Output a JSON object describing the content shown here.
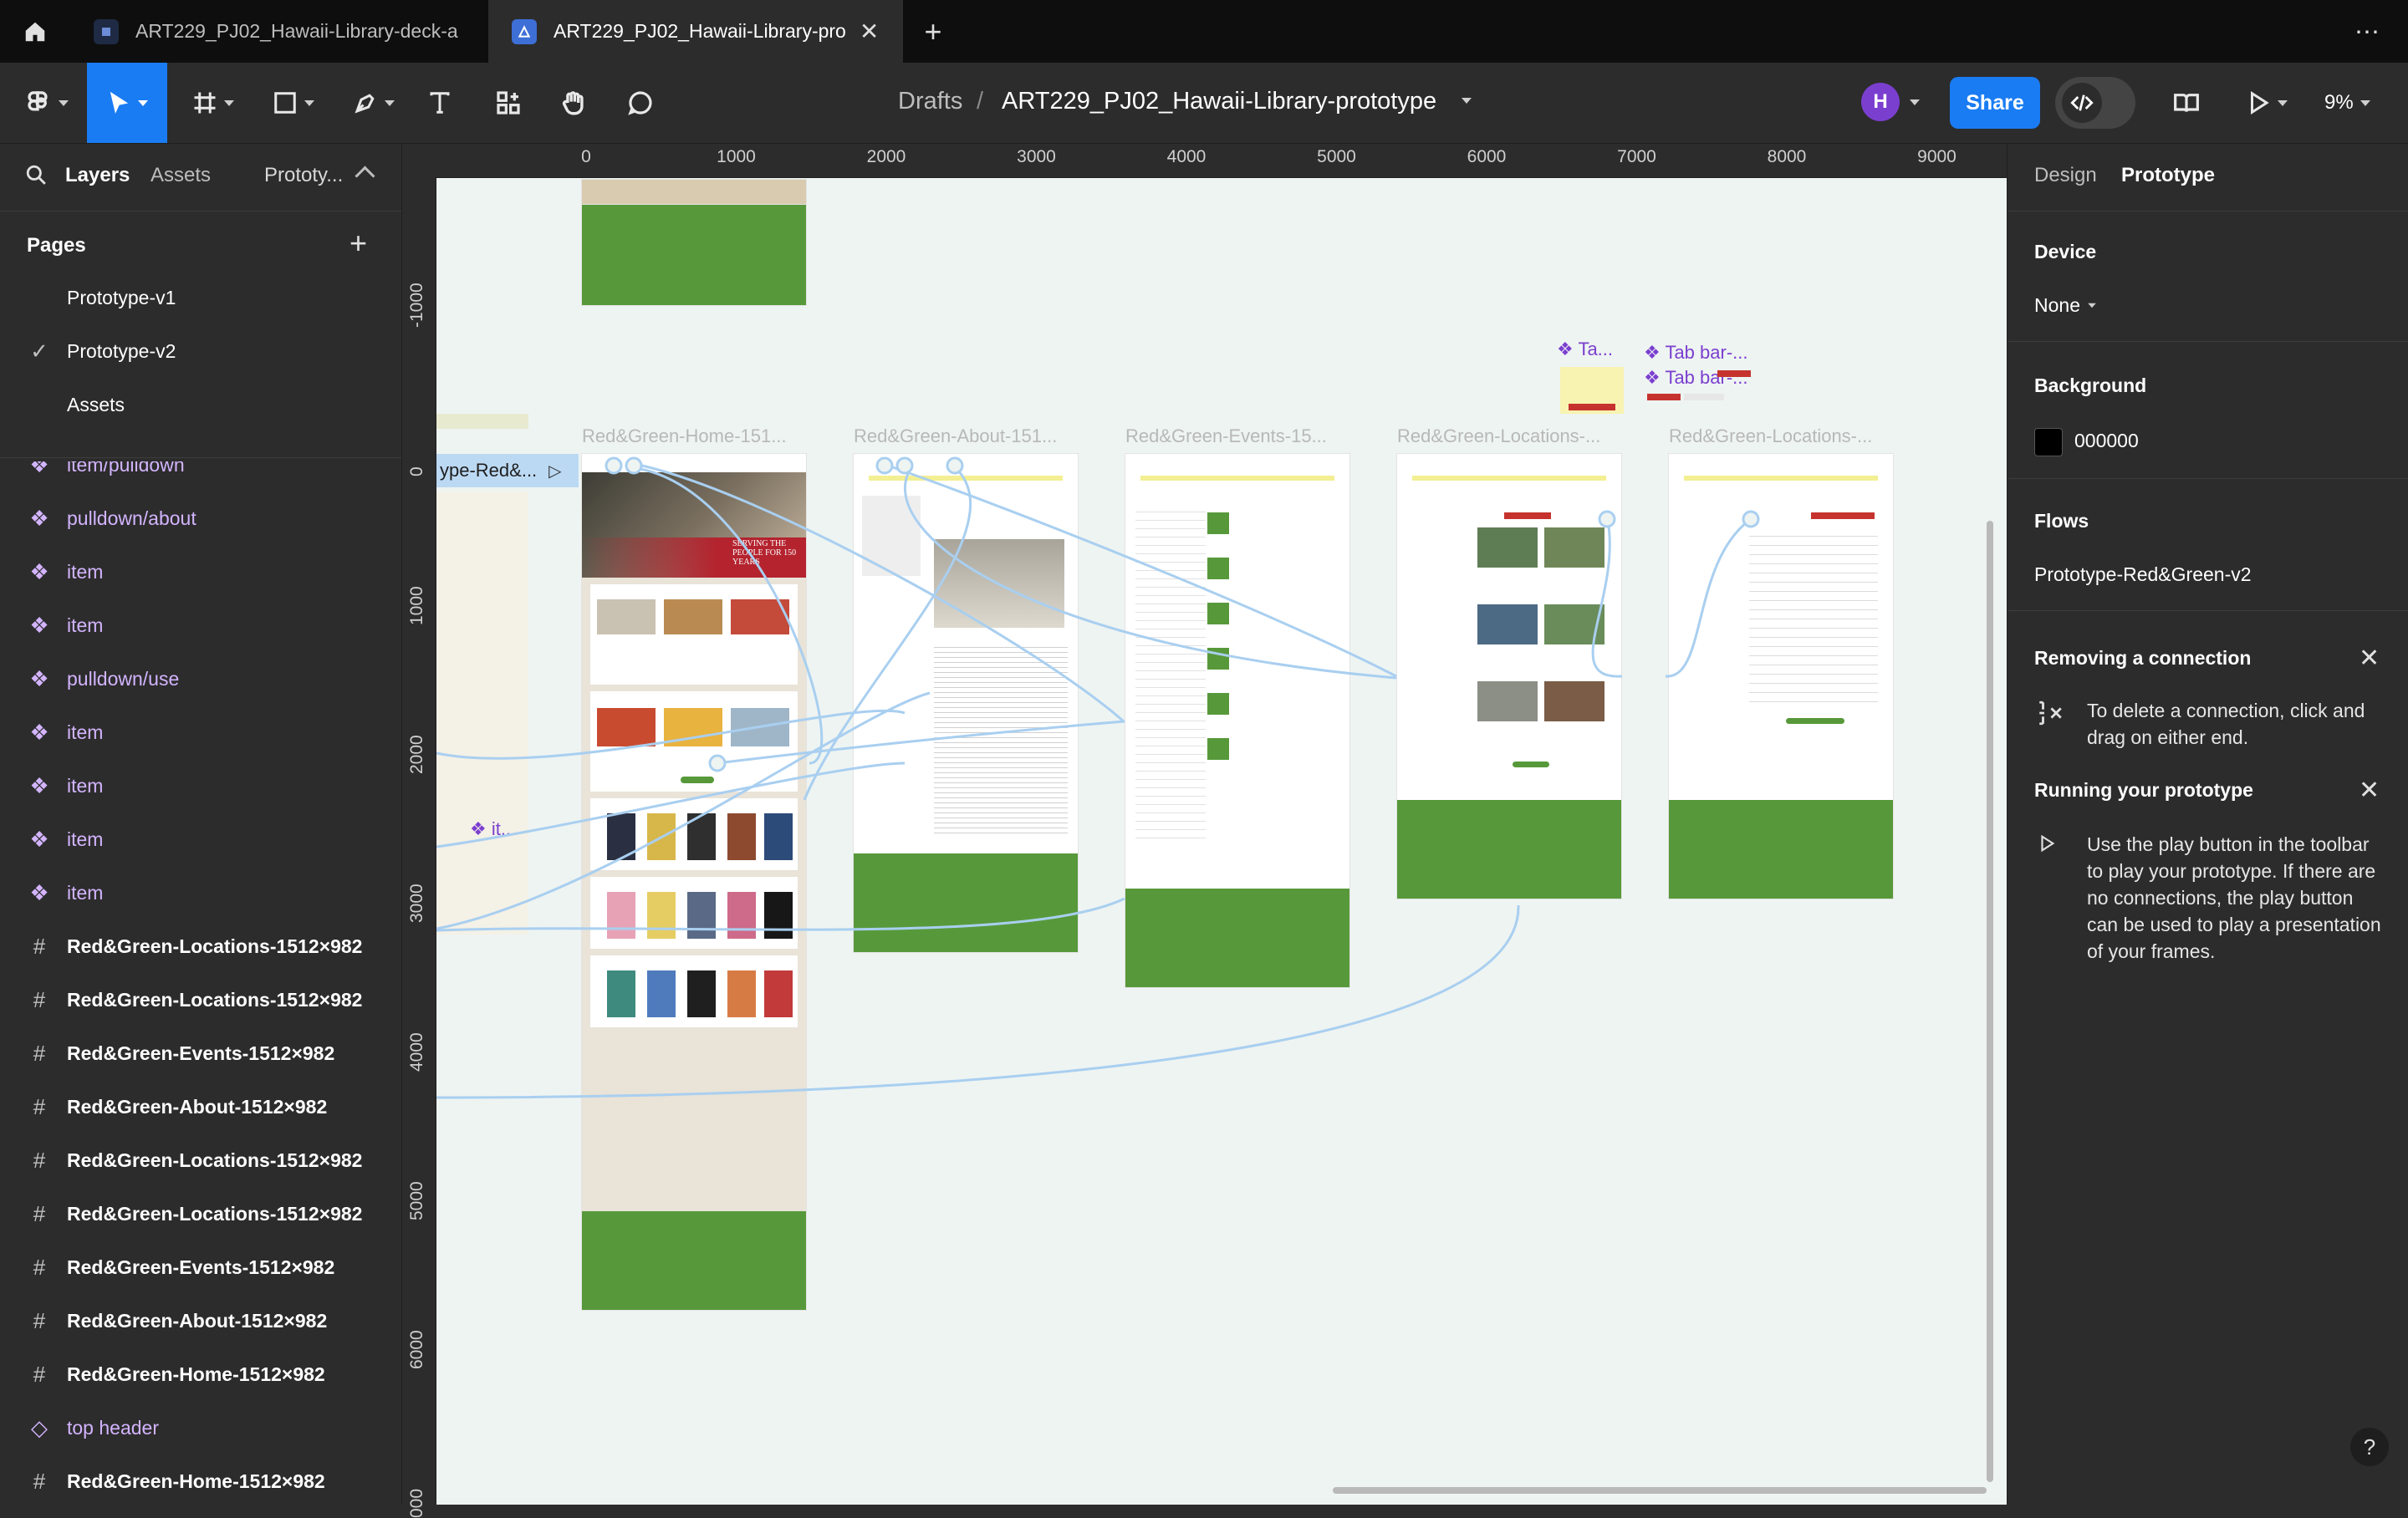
{
  "tabs": [
    {
      "label": "ART229_PJ02_Hawaii-Library-deck-a",
      "active": false
    },
    {
      "label": "ART229_PJ02_Hawaii-Library-pro",
      "active": true
    }
  ],
  "toolbar": {
    "breadcrumb_parent": "Drafts",
    "breadcrumb_sep": "/",
    "file_name": "ART229_PJ02_Hawaii-Library-prototype",
    "avatar_initial": "H",
    "share_label": "Share",
    "zoom": "9%"
  },
  "left_panel": {
    "tabs": [
      "Layers",
      "Assets",
      "Prototy..."
    ],
    "pages_title": "Pages",
    "pages": [
      {
        "name": "Prototype-v1",
        "current": false
      },
      {
        "name": "Prototype-v2",
        "current": true
      },
      {
        "name": "Assets",
        "current": false
      }
    ],
    "layers": [
      {
        "name": "item/pulldown",
        "kind": "component"
      },
      {
        "name": "pulldown/about",
        "kind": "component"
      },
      {
        "name": "item",
        "kind": "component"
      },
      {
        "name": "item",
        "kind": "component"
      },
      {
        "name": "pulldown/use",
        "kind": "component"
      },
      {
        "name": "item",
        "kind": "component"
      },
      {
        "name": "item",
        "kind": "component"
      },
      {
        "name": "item",
        "kind": "component"
      },
      {
        "name": "item",
        "kind": "component"
      },
      {
        "name": "Red&Green-Locations-1512×982",
        "kind": "frame"
      },
      {
        "name": "Red&Green-Locations-1512×982",
        "kind": "frame"
      },
      {
        "name": "Red&Green-Events-1512×982",
        "kind": "frame"
      },
      {
        "name": "Red&Green-About-1512×982",
        "kind": "frame"
      },
      {
        "name": "Red&Green-Locations-1512×982",
        "kind": "frame"
      },
      {
        "name": "Red&Green-Locations-1512×982",
        "kind": "frame"
      },
      {
        "name": "Red&Green-Events-1512×982",
        "kind": "frame"
      },
      {
        "name": "Red&Green-About-1512×982",
        "kind": "frame"
      },
      {
        "name": "Red&Green-Home-1512×982",
        "kind": "frame"
      },
      {
        "name": "top header",
        "kind": "component-instance"
      },
      {
        "name": "Red&Green-Home-1512×982",
        "kind": "frame"
      }
    ]
  },
  "rulers": {
    "top": [
      "0",
      "1000",
      "2000",
      "3000",
      "4000",
      "5000",
      "6000",
      "7000",
      "8000",
      "9000"
    ],
    "left": [
      "-1000",
      "0",
      "1000",
      "2000",
      "3000",
      "4000",
      "5000",
      "6000",
      "000"
    ]
  },
  "canvas": {
    "frame_labels": [
      "Red&Green-Home-151...",
      "Red&Green-About-151...",
      "Red&Green-Events-15...",
      "Red&Green-Locations-...",
      "Red&Green-Locations-..."
    ],
    "left_cut_label": "ype-Red&...",
    "small_labels": [
      "Ta...",
      "Tab bar-...",
      "Tab bar-...",
      "it..."
    ],
    "hero_text": "SERVING THE PEOPLE FOR 150 YEARS"
  },
  "right_panel": {
    "tabs": [
      "Design",
      "Prototype"
    ],
    "active_tab": "Prototype",
    "device_title": "Device",
    "device_value": "None",
    "background_title": "Background",
    "background_value": "000000",
    "flows_title": "Flows",
    "flow_name": "Prototype-Red&Green-v2",
    "hint1_title": "Removing a connection",
    "hint1_body": "To delete a connection, click and drag on either end.",
    "hint2_title": "Running your prototype",
    "hint2_body": "Use the play button in the toolbar to play your prototype. If there are no connections, the play button can be used to play a presentation of your frames."
  },
  "colors": {
    "accent": "#1a7cf3",
    "component": "#d3b4ff",
    "frame_green": "#57993a",
    "canvas_bg": "#eef4f2",
    "prototype_link": "#a9cff0"
  }
}
